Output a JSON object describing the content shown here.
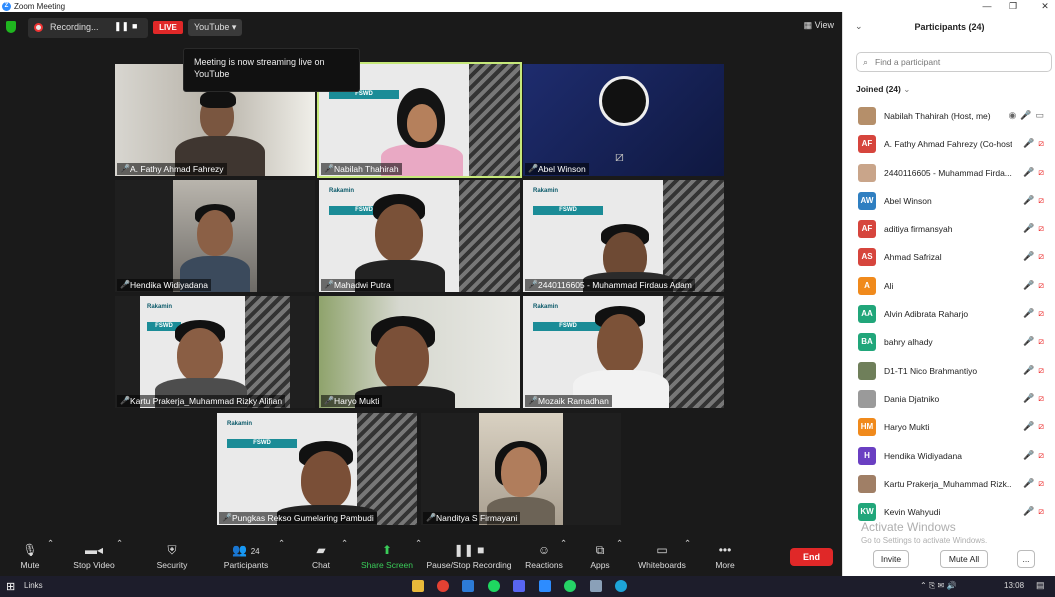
{
  "window": {
    "title": "Zoom Meeting"
  },
  "topbar": {
    "recording_label": "Recording...",
    "live_label": "LIVE",
    "stream_target": "YouTube ▾",
    "view_label": "View",
    "tooltip": "Meeting is now streaming live on YouTube"
  },
  "rakamin": {
    "brand": "Rakamin",
    "badge": "FSWD"
  },
  "tiles": [
    {
      "name": "A. Fathy Ahmad Fahrezy"
    },
    {
      "name": "Nabilah Thahirah"
    },
    {
      "name": "Abel Winson"
    },
    {
      "name": "Hendika Widiyadana"
    },
    {
      "name": "Mahadwi Putra"
    },
    {
      "name": "2440116605 - Muhammad Firdaus Adam"
    },
    {
      "name": "Kartu Prakerja_Muhammad Rizky Alifian"
    },
    {
      "name": "Haryo Mukti"
    },
    {
      "name": "Mozaik Ramadhan"
    },
    {
      "name": "Pungkas Rekso Gumelaring Pambudi"
    },
    {
      "name": "Nanditya S Firmayani"
    }
  ],
  "toolbar": {
    "mute": "Mute",
    "stop_video": "Stop Video",
    "security": "Security",
    "participants": "Participants",
    "participants_count": "24",
    "chat": "Chat",
    "share_screen": "Share Screen",
    "pause_recording": "Pause/Stop Recording",
    "reactions": "Reactions",
    "apps": "Apps",
    "whiteboards": "Whiteboards",
    "more": "More",
    "end": "End"
  },
  "panel": {
    "title": "Participants (24)",
    "search_placeholder": "Find a participant",
    "joined": "Joined (24)",
    "participants": [
      {
        "initials": "",
        "name": "Nabilah Thahirah (Host, me)",
        "color": "#b58f6a",
        "photo": true,
        "host": true
      },
      {
        "initials": "AF",
        "name": "A. Fathy Ahmad Fahrezy (Co-host)",
        "color": "#d6453d"
      },
      {
        "initials": "",
        "name": "2440116605 - Muhammad Firda...",
        "color": "#c9a58a",
        "photo": true
      },
      {
        "initials": "AW",
        "name": "Abel Winson",
        "color": "#2f7fc1"
      },
      {
        "initials": "AF",
        "name": "aditiya firmansyah",
        "color": "#d6453d"
      },
      {
        "initials": "AS",
        "name": "Ahmad Safrizal",
        "color": "#d6453d"
      },
      {
        "initials": "A",
        "name": "Ali",
        "color": "#f08a1c"
      },
      {
        "initials": "AA",
        "name": "Alvin Adibrata Raharjo",
        "color": "#21a67a"
      },
      {
        "initials": "BA",
        "name": "bahry alhady",
        "color": "#21a67a"
      },
      {
        "initials": "",
        "name": "D1-T1 Nico Brahmantiyo",
        "color": "#6f7f5a",
        "photo": true
      },
      {
        "initials": "",
        "name": "Dania Djatniko",
        "color": "#9a9a9a",
        "photo": true
      },
      {
        "initials": "HM",
        "name": "Haryo Mukti",
        "color": "#f08a1c"
      },
      {
        "initials": "H",
        "name": "Hendika Widiyadana",
        "color": "#6a3fc2"
      },
      {
        "initials": "",
        "name": "Kartu Prakerja_Muhammad Rizk...",
        "color": "#a07f66",
        "photo": true
      },
      {
        "initials": "KW",
        "name": "Kevin Wahyudi",
        "color": "#21a67a"
      }
    ],
    "watermark_title": "Activate Windows",
    "watermark_sub": "Go to Settings to activate Windows.",
    "invite": "Invite",
    "mute_all": "Mute All",
    "more": "..."
  },
  "taskbar": {
    "links": "Links",
    "time": "13:08"
  }
}
